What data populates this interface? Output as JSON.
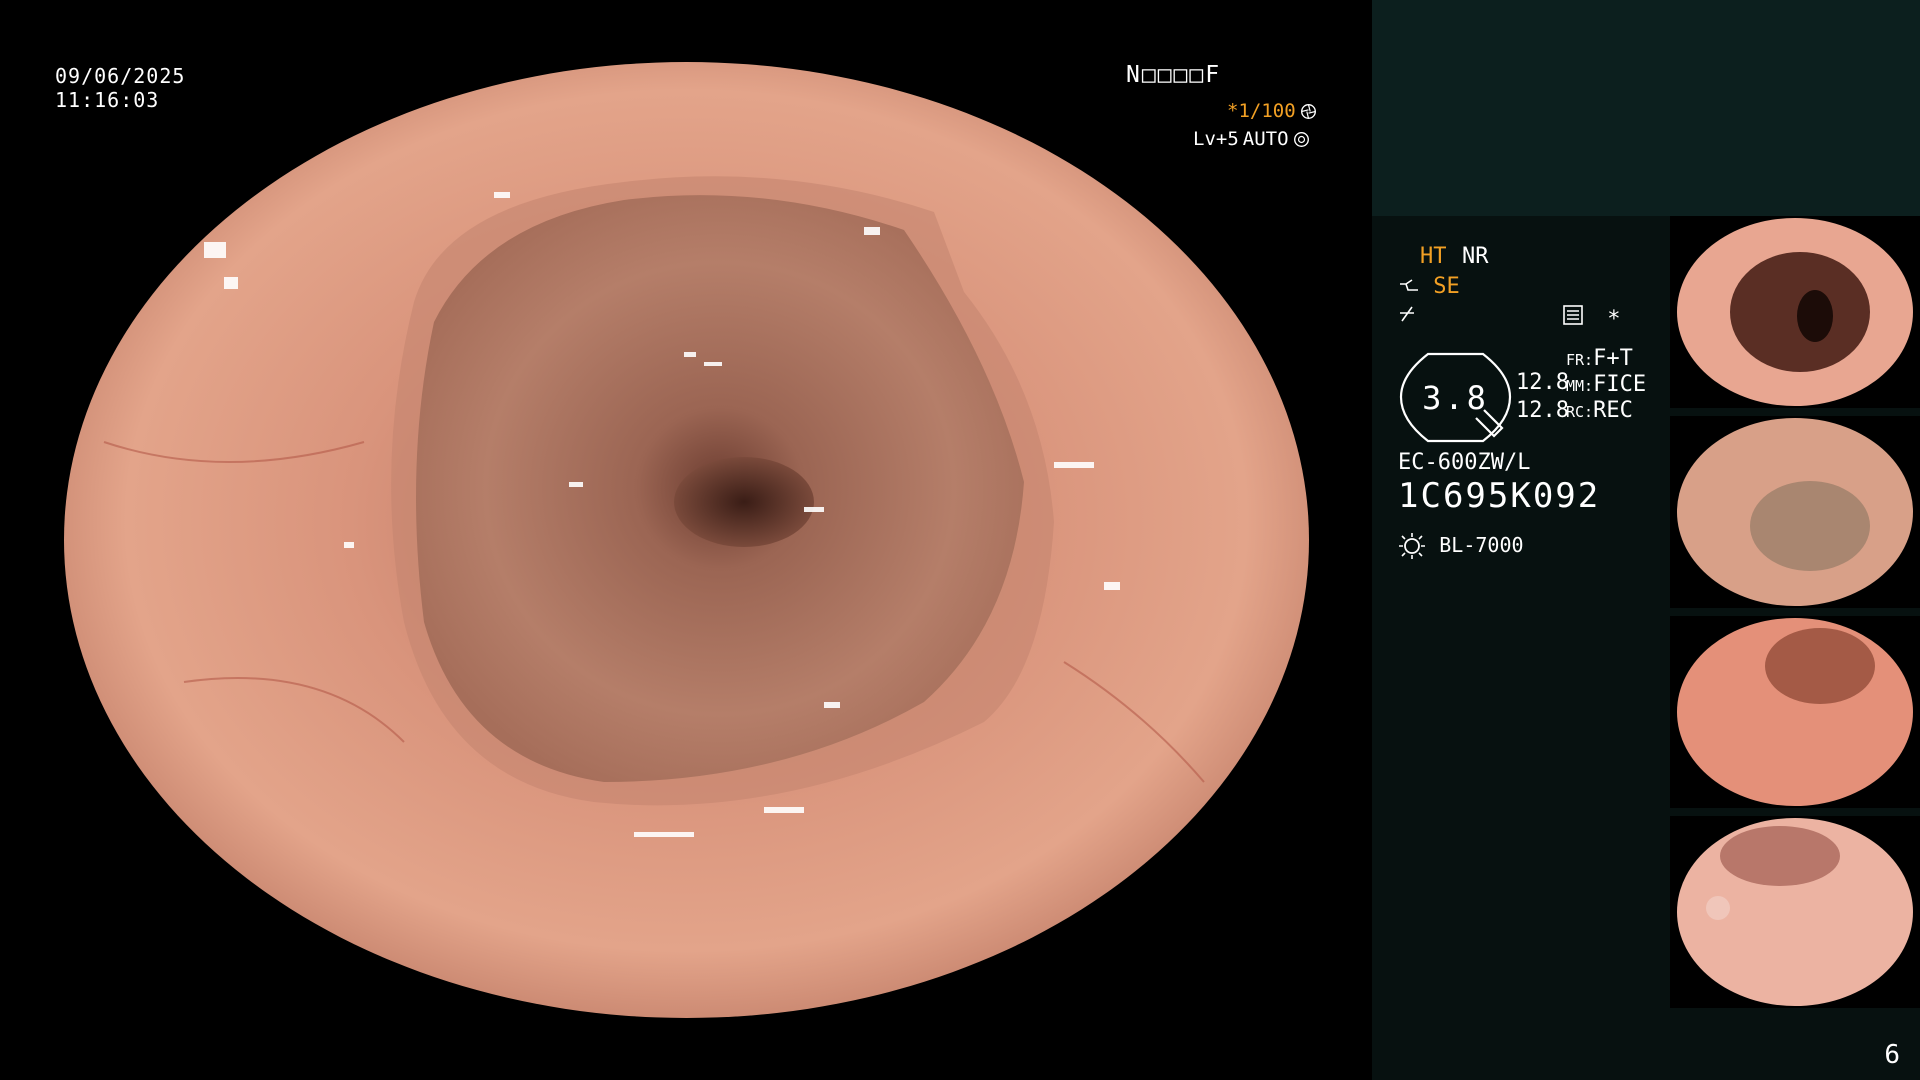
{
  "overlay": {
    "date": "09/06/2025",
    "time": "11:16:03",
    "mode_code": "N□□□□F",
    "shutter": "*1/100",
    "light_level": "Lv+5",
    "light_mode": "AUTO"
  },
  "settings": {
    "ht": "HT",
    "nr": "NR",
    "se": "SE",
    "zoom": "3.8",
    "fr_label": "FR:",
    "fr_value": "F+T",
    "mm_label": "MM:",
    "mm_value": "FICE",
    "rc_label": "RC:",
    "rc_value": "REC",
    "val1": "12.8",
    "val2": "12.8",
    "scope_model": "EC-600ZW/L",
    "serial": "1C695K092",
    "light_source": "BL-7000",
    "star": "*"
  },
  "thumbnails": [
    {
      "label": "thumbnail-1"
    },
    {
      "label": "thumbnail-2"
    },
    {
      "label": "thumbnail-3"
    },
    {
      "label": "thumbnail-4"
    }
  ],
  "page_number": "6",
  "colors": {
    "accent": "#f2a024",
    "panel_bg": "#071110",
    "panel_top": "#0c1f1e"
  }
}
